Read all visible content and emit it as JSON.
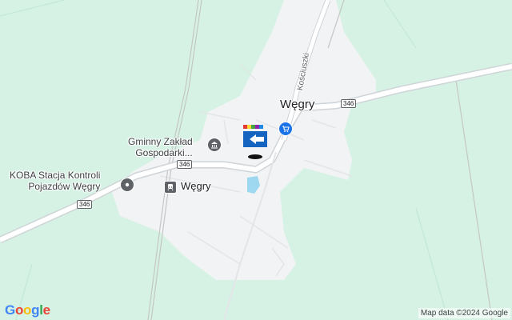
{
  "map": {
    "town_label": "Węgry",
    "street_label": "Kościuszki",
    "poi_gminny": "Gminny Zakład\nGospodarki...",
    "poi_koba": "KOBA Stacja Kontroli\nPojazdów Węgry",
    "station_label": "Węgry",
    "road_shields": [
      "346",
      "346",
      "346"
    ],
    "colors": {
      "land": "#d6f2e4",
      "builtup": "#f1f3f4",
      "road": "#ffffff",
      "water": "#9ed8f0",
      "rail": "#c4c7c5",
      "poi_icon": "#5f6368",
      "shop_icon": "#1a73e8"
    },
    "icons": [
      "museum-icon",
      "shop-icon",
      "train-station-icon",
      "business-logo-icon"
    ]
  },
  "footer": {
    "attribution": "Map data ©2024 Google",
    "logo": {
      "g1": "G",
      "o1": "o",
      "o2": "o",
      "g2": "g",
      "l": "l",
      "e": "e"
    }
  }
}
